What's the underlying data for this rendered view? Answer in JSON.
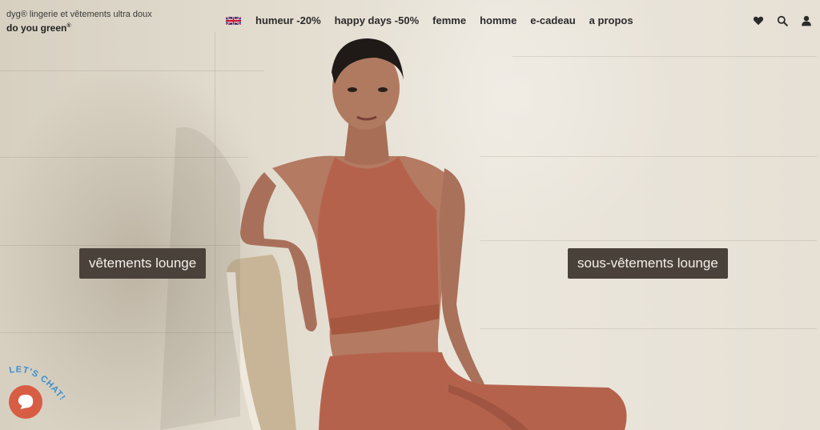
{
  "header": {
    "tagline": "dyg® lingerie et vêtements ultra doux",
    "brand": "do you green",
    "brand_mark": "®",
    "language_flag": "uk-flag-icon",
    "nav": [
      {
        "label": "humeur -20%"
      },
      {
        "label": "happy days -50%"
      },
      {
        "label": "femme"
      },
      {
        "label": "homme"
      },
      {
        "label": "e-cadeau"
      },
      {
        "label": "a propos"
      }
    ],
    "icons": [
      "heart-icon",
      "search-icon",
      "user-icon"
    ]
  },
  "hero": {
    "cta_left": "vêtements lounge",
    "cta_right": "sous-vêtements lounge"
  },
  "chat": {
    "label": "LET'S CHAT!",
    "accent_color": "#d85d45",
    "label_color": "#3a8fcf"
  },
  "colors": {
    "cta_bg": "#4b413b",
    "garment": "#b5624d"
  }
}
